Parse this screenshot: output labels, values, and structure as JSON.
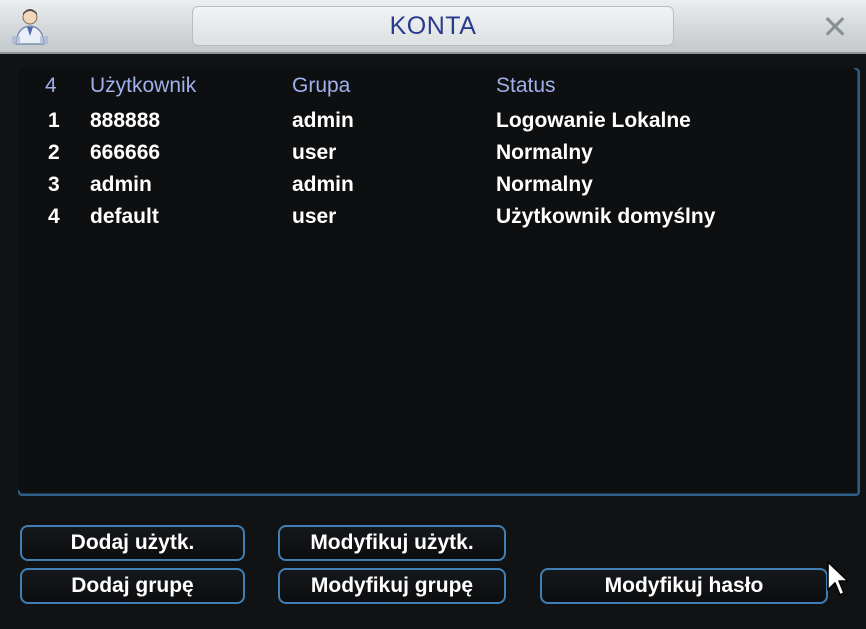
{
  "window": {
    "title": "KONTA",
    "close_glyph": "✕"
  },
  "table": {
    "headers": {
      "count": "4",
      "user": "Użytkownik",
      "group": "Grupa",
      "status": "Status"
    },
    "rows": [
      {
        "num": "1",
        "user": "888888",
        "group": "admin",
        "status": "Logowanie Lokalne"
      },
      {
        "num": "2",
        "user": "666666",
        "group": "user",
        "status": "Normalny"
      },
      {
        "num": "3",
        "user": "admin",
        "group": "admin",
        "status": "Normalny"
      },
      {
        "num": "4",
        "user": "default",
        "group": "user",
        "status": "Użytkownik domyślny"
      }
    ]
  },
  "buttons": {
    "add_user": "Dodaj użytk.",
    "modify_user": "Modyfikuj użytk.",
    "add_group": "Dodaj grupę",
    "modify_group": "Modyfikuj grupę",
    "modify_password": "Modyfikuj hasło"
  },
  "icons": {
    "app": "users-icon",
    "close": "close-icon",
    "cursor": "mouse-pointer-icon"
  },
  "colors": {
    "title_text": "#2a3a8c",
    "header_text": "#9fb0ea",
    "border_accent": "#3f7fb5"
  }
}
